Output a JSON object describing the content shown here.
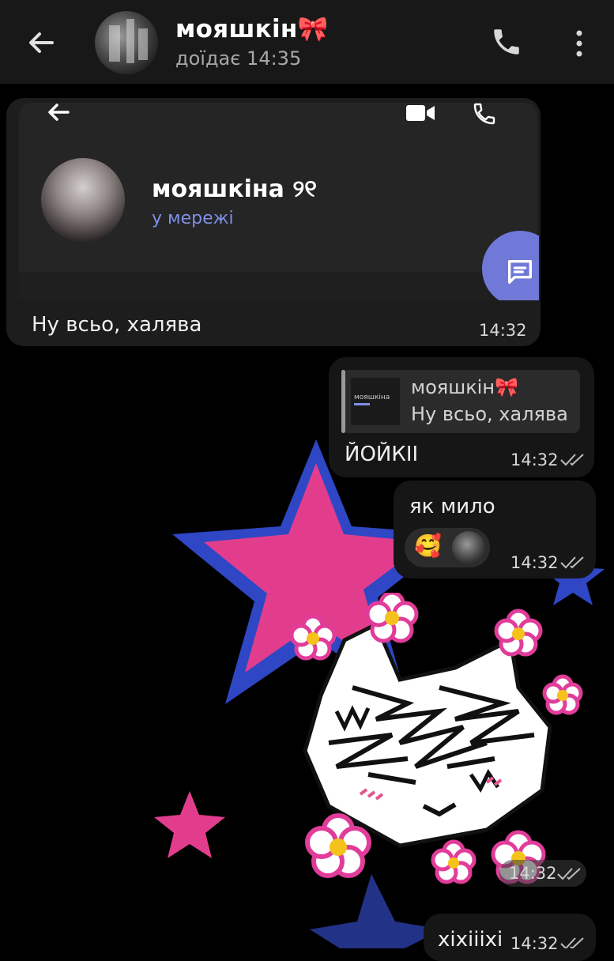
{
  "header": {
    "title": "мояшкін🎀",
    "status": "доїдає 14:35",
    "icons": {
      "back": "back-arrow-icon",
      "call": "phone-icon",
      "menu": "more-vertical-icon"
    }
  },
  "messages": [
    {
      "direction": "incoming",
      "screenshot": {
        "contact_name": "мояшкіна ୨୧",
        "contact_status": "у мережі"
      },
      "text": "Ну всьо,  халява",
      "time": "14:32"
    },
    {
      "direction": "outgoing",
      "reply_to": {
        "author": "мояшкін🎀",
        "text": "Ну всьо,  халява",
        "thumb_text": "мояшкіна"
      },
      "text": "ЙОЙКІІ",
      "time": "14:32",
      "read": true
    },
    {
      "direction": "outgoing",
      "text": "як мило",
      "reaction_emoji": "🥰",
      "time": "14:32",
      "read": true
    },
    {
      "direction": "outgoing",
      "type": "sticker",
      "sticker": "wolf-flowers-sticker",
      "time": "14:32",
      "read": true
    },
    {
      "direction": "outgoing",
      "text": "хіхіііхі",
      "time": "14:32",
      "read": true
    }
  ],
  "colors": {
    "header_bg": "#181818",
    "bubble_bg": "#1d1d1d",
    "accent_blue": "#7079d8",
    "star_blue": "#3a4fc0",
    "star_pink": "#e8358f"
  }
}
